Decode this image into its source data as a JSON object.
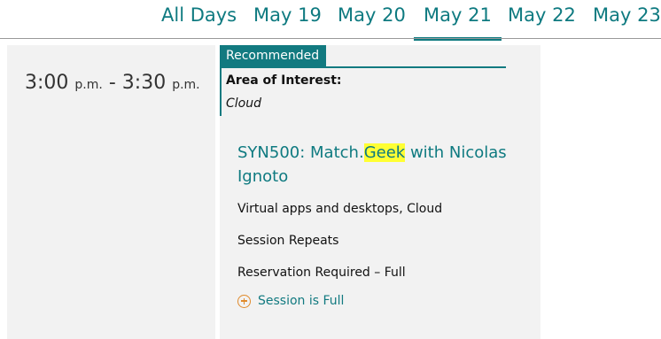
{
  "tabs": [
    {
      "label": "All Days"
    },
    {
      "label": "May 19"
    },
    {
      "label": "May 20"
    },
    {
      "label": "May 21"
    },
    {
      "label": "May 22"
    },
    {
      "label": "May 23"
    }
  ],
  "active_tab": "May 21",
  "timeslot": {
    "start": "3:00",
    "start_suffix": "p.m.",
    "separator": "-",
    "end": "3:30",
    "end_suffix": "p.m."
  },
  "session": {
    "badge": "Recommended",
    "area_label": "Area of Interest:",
    "area_value": "Cloud",
    "title_before": "SYN500: Match.",
    "title_highlight": "Geek",
    "title_after": " with Nicolas Ignoto",
    "tracks": "Virtual apps and desktops, Cloud",
    "repeats": "Session Repeats",
    "reservation": "Reservation Required – Full",
    "action": "Session is Full"
  },
  "colors": {
    "accent": "#0e7a80",
    "highlight": "#ffff33",
    "icon": "#e08a2b",
    "panel": "#f2f2f2"
  }
}
